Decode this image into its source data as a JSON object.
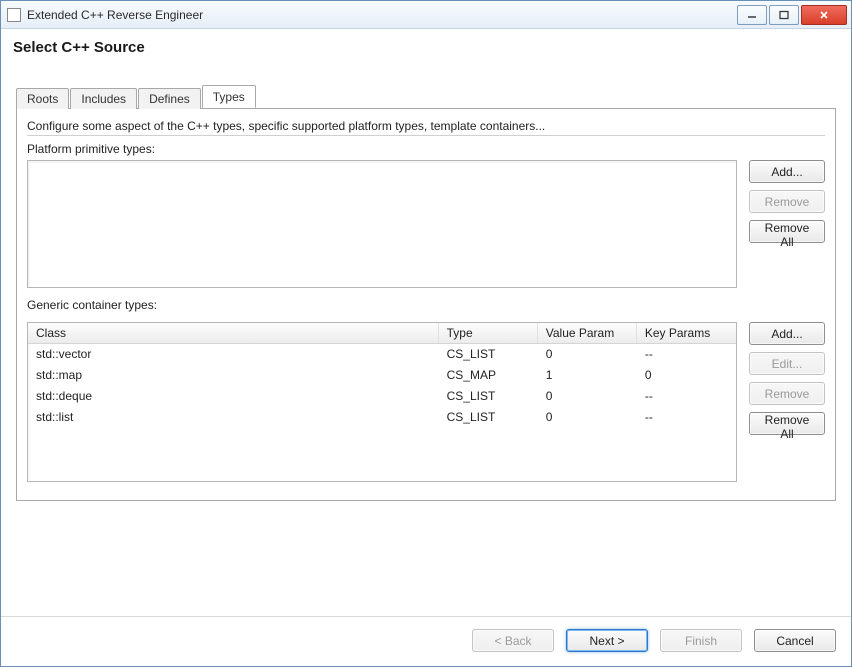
{
  "window_title": "Extended C++ Reverse Engineer",
  "page_title": "Select C++ Source",
  "tabs": {
    "roots": "Roots",
    "includes": "Includes",
    "defines": "Defines",
    "types": "Types"
  },
  "desc": "Configure some aspect of the C++ types, specific supported platform types, template containers...",
  "labels": {
    "platform": "Platform primitive types:",
    "generic": "Generic container types:"
  },
  "buttons": {
    "add": "Add...",
    "edit": "Edit...",
    "remove": "Remove",
    "remove_all": "Remove All",
    "back": "< Back",
    "next": "Next >",
    "finish": "Finish",
    "cancel": "Cancel"
  },
  "table": {
    "headers": {
      "class": "Class",
      "type": "Type",
      "value_param": "Value Param",
      "key_params": "Key Params"
    },
    "rows": [
      {
        "class": "std::vector",
        "type": "CS_LIST",
        "value_param": "0",
        "key_params": "--"
      },
      {
        "class": "std::map",
        "type": "CS_MAP",
        "value_param": "1",
        "key_params": "0"
      },
      {
        "class": "std::deque",
        "type": "CS_LIST",
        "value_param": "0",
        "key_params": "--"
      },
      {
        "class": "std::list",
        "type": "CS_LIST",
        "value_param": "0",
        "key_params": "--"
      }
    ]
  }
}
